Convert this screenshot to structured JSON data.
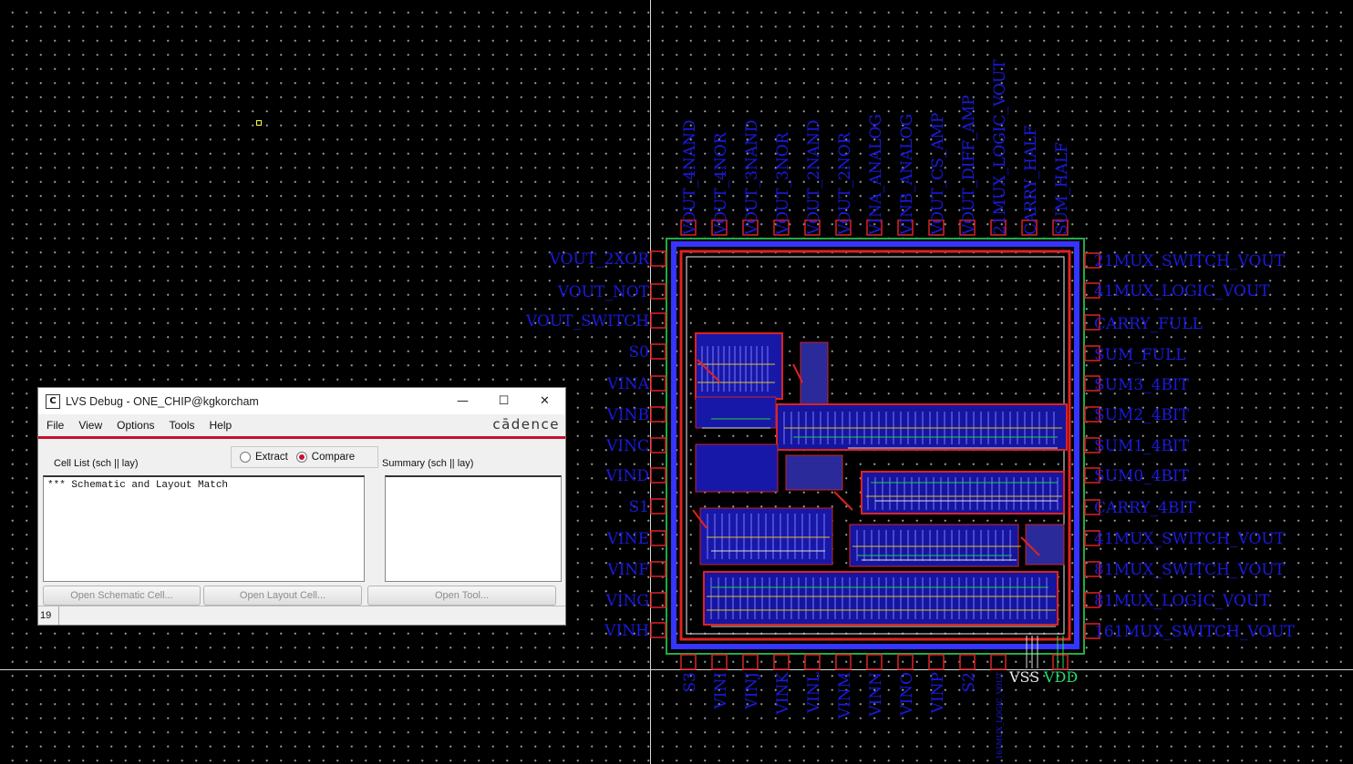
{
  "canvas": {
    "pins_top": [
      "VOUT_4NAND",
      "VOUT_4NOR",
      "VOUT_3NAND",
      "VOUT_3NOR",
      "VOUT_2NAND",
      "VOUT_2NOR",
      "VINA_ANALOG",
      "VINB_ANALOG",
      "VOUT_CS_AMP",
      "VOUT_DIFF_AMP",
      "21MUX_LOGIC_VOUT",
      "CARRY_HALF",
      "SUM_HALF"
    ],
    "pins_left": [
      "VOUT_2XOR",
      "VOUT_NOT",
      "VOUT_SWITCH",
      "S0",
      "VINA",
      "VINB",
      "VINC",
      "VIND",
      "S1",
      "VINE",
      "VINF",
      "VING",
      "VINH"
    ],
    "pins_right": [
      "21MUX_SWITCH_VOUT",
      "41MUX_LOGIC_VOUT",
      "CARRY_FULL",
      "SUM_FULL",
      "SUM3_4BIT",
      "SUM2_4BIT",
      "SUM1_4BIT",
      "SUM0_4BIT",
      "CARRY_4BIT",
      "41MUX_SWITCH_VOUT",
      "81MUX_SWITCH_VOUT",
      "81MUX_LOGIC_VOUT",
      "161MUX_SWITCH_VOUT"
    ],
    "pins_bottom": [
      "S3",
      "VINI",
      "VINJ",
      "VINK",
      "VINL",
      "VINM",
      "VINN",
      "VINO",
      "VINP",
      "S2",
      "161MUX_LOGIC_VOUT"
    ],
    "power_vss": "VSS",
    "power_vdd": "VDD",
    "colors": {
      "pin_text": "#1a1adf",
      "background": "#000000",
      "vdd_text": "#22dd66"
    }
  },
  "dialog": {
    "title": "LVS Debug - ONE_CHIP@kgkorcham",
    "icon": "cadence-app-icon",
    "window_buttons": {
      "minimize": "—",
      "maximize": "☐",
      "close": "✕"
    },
    "menu": [
      "File",
      "View",
      "Options",
      "Tools",
      "Help"
    ],
    "brand": "cādence",
    "cell_list_label": "Cell List (sch || lay)",
    "summary_label": "Summary (sch || lay)",
    "mode": {
      "extract": "Extract",
      "compare": "Compare",
      "selected": "Compare"
    },
    "cell_list_items": [
      "*** Schematic and Layout Match"
    ],
    "buttons": {
      "open_schematic": "Open Schematic Cell...",
      "open_layout": "Open Layout Cell...",
      "open_tool": "Open Tool..."
    },
    "status_count": "19",
    "accent": "#c8102e"
  }
}
